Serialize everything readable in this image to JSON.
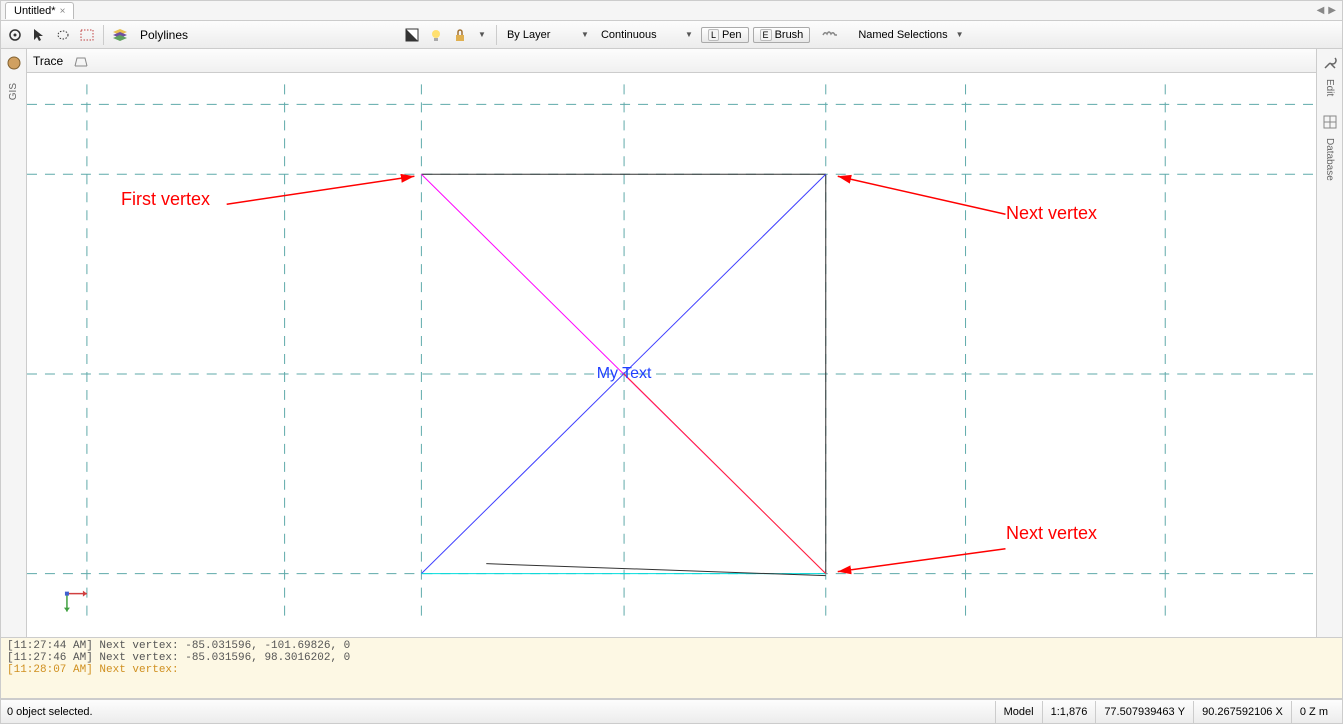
{
  "tab": {
    "title": "Untitled*"
  },
  "toolbar": {
    "layer_type": "Polylines",
    "color_mode": "By Layer",
    "line_style": "Continuous",
    "pen_label": "Pen",
    "pen_key": "L",
    "brush_label": "Brush",
    "brush_key": "E",
    "named_selections": "Named Selections"
  },
  "subtoolbar": {
    "trace": "Trace"
  },
  "side_left": {
    "gis": "GIS"
  },
  "side_right": {
    "edit": "Edit",
    "database": "Database"
  },
  "canvas": {
    "center_text": "My Text",
    "annotations": {
      "first_vertex": "First vertex",
      "next_vertex_1": "Next vertex",
      "next_vertex_2": "Next vertex"
    }
  },
  "console": {
    "lines": [
      "[11:27:44 AM] Next vertex: -85.031596, -101.69826, 0",
      "[11:27:46 AM] Next vertex: -85.031596, 98.3016202, 0"
    ],
    "current": "[11:28:07 AM] Next vertex:"
  },
  "status": {
    "selection": "0 object selected.",
    "model": "Model",
    "scale": "1:1,876",
    "x": "77.507939463",
    "x_label": "Y",
    "y": "90.267592106",
    "y_label": "X",
    "z": "0",
    "z_label": "Z",
    "unit": "m"
  }
}
